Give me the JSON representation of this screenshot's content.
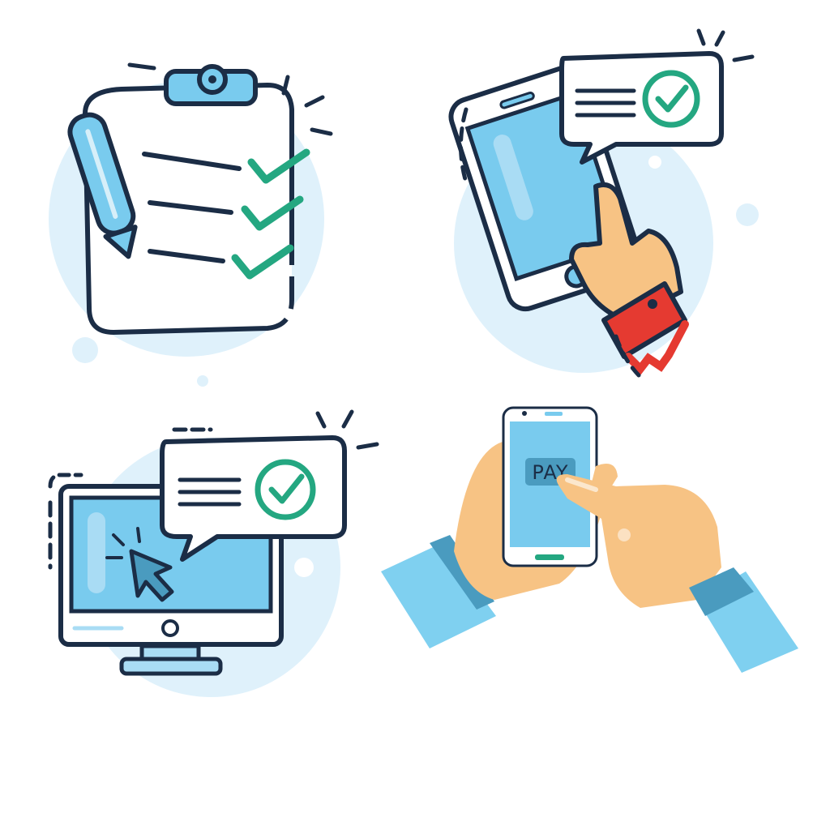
{
  "illustrations": [
    {
      "id": "checklist",
      "icon": "clipboard-checklist-icon"
    },
    {
      "id": "phone-message",
      "icon": "smartphone-confirmation-icon"
    },
    {
      "id": "computer-message",
      "icon": "computer-confirmation-icon"
    },
    {
      "id": "mobile-payment",
      "icon": "mobile-payment-icon"
    }
  ],
  "payment": {
    "button_label": "PAY"
  },
  "colors": {
    "outline": "#1b2d46",
    "light_blue": "#a9dcf4",
    "blue": "#79cbee",
    "check": "#24a781",
    "skin": "#f7c384",
    "sleeve": "#7fd0f0",
    "cuff_dark": "#4a9bbf",
    "strap_red": "#e53a31",
    "halo": "#dff1fb"
  }
}
